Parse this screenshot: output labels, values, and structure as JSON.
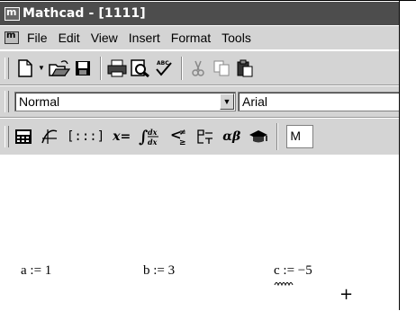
{
  "window": {
    "title": "Mathcad - [1111]",
    "app_icon": "mathcad-icon"
  },
  "menubar": {
    "doc_icon": "mathcad-document-icon",
    "items": [
      "File",
      "Edit",
      "View",
      "Insert",
      "Format",
      "Tools"
    ]
  },
  "standard_toolbar": {
    "buttons": [
      {
        "icon": "new-document-icon"
      },
      {
        "icon": "open-folder-icon"
      },
      {
        "icon": "save-disk-icon"
      },
      {
        "icon": "print-icon"
      },
      {
        "icon": "print-preview-icon"
      },
      {
        "icon": "spell-check-icon"
      },
      {
        "icon": "cut-icon"
      },
      {
        "icon": "copy-icon"
      },
      {
        "icon": "paste-icon"
      }
    ]
  },
  "formatting_toolbar": {
    "style_value": "Normal",
    "font_value": "Arial"
  },
  "math_toolbar": {
    "buttons": [
      {
        "icon": "calculator-icon"
      },
      {
        "icon": "graph-icon"
      },
      {
        "icon": "matrix-icon",
        "glyph": "[:::]"
      },
      {
        "icon": "evaluation-icon",
        "glyph": "x="
      },
      {
        "icon": "calculus-icon"
      },
      {
        "icon": "boolean-icon"
      },
      {
        "icon": "programming-icon"
      },
      {
        "icon": "greek-icon",
        "glyph": "αβ"
      },
      {
        "icon": "symbolic-icon"
      }
    ],
    "combo_value": "M"
  },
  "worksheet": {
    "expressions": [
      {
        "text": "a := 1"
      },
      {
        "text": "b := 3"
      },
      {
        "text": "c := −5"
      }
    ]
  }
}
